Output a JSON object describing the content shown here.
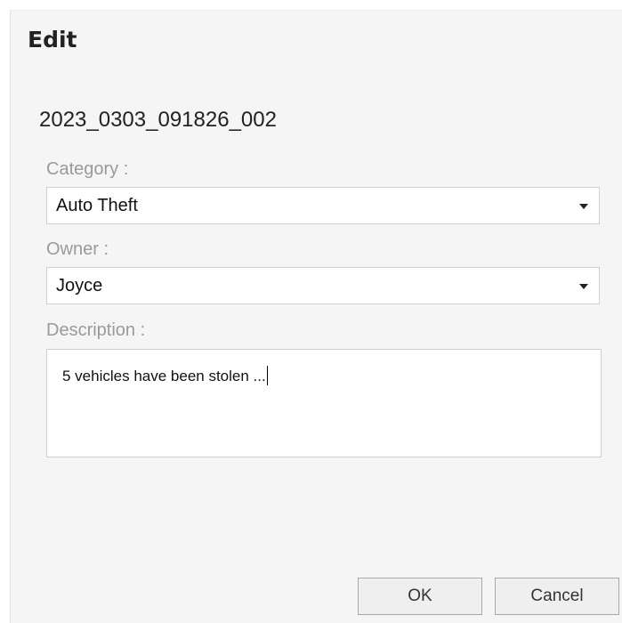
{
  "dialog": {
    "title": "Edit",
    "record_name": "2023_0303_091826_002"
  },
  "form": {
    "category": {
      "label": "Category :",
      "value": "Auto Theft",
      "icon": "caret-down-icon"
    },
    "owner": {
      "label": "Owner :",
      "value": "Joyce",
      "icon": "caret-down-icon"
    },
    "description": {
      "label": "Description :",
      "value": "5 vehicles have been stolen ..."
    }
  },
  "buttons": {
    "ok_label": "OK",
    "cancel_label": "Cancel"
  },
  "colors": {
    "dialog_background": "#f5f5f5",
    "label_text": "#9a9a9a",
    "field_border": "#cfcfcf"
  }
}
